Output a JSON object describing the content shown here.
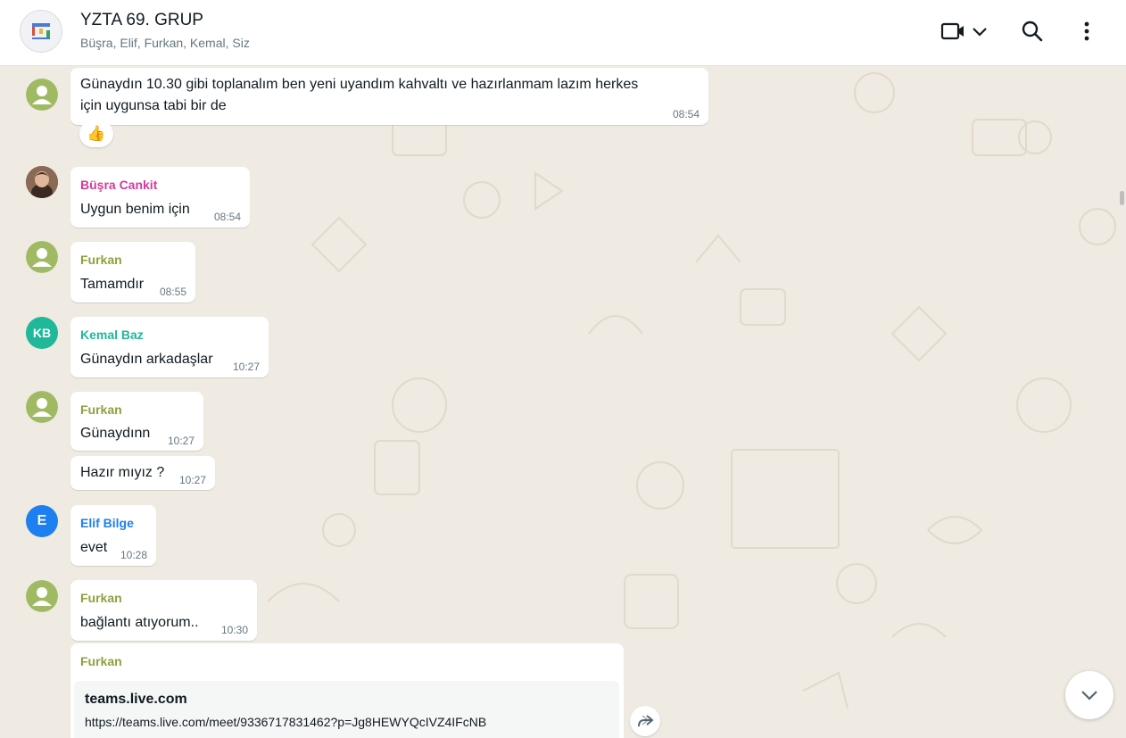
{
  "header": {
    "title": "YZTA 69. GRUP",
    "members": "Büşra, Elif, Furkan, Kemal, Siz"
  },
  "colors": {
    "background": "#efeae2",
    "furkan": "#8ba33b",
    "busra": "#d63a9c",
    "kemal": "#1fb89a",
    "elif": "#1d7ff0"
  },
  "icons": {
    "video_call": "video-camera",
    "dropdown": "chevron-down",
    "search": "magnifier",
    "menu": "vertical-dots",
    "reaction": "👍",
    "forward": "forward-arrow",
    "scroll_down": "chevron-down"
  },
  "messages": [
    {
      "sender": "",
      "text_line1": "Günaydın 10.30 gibi toplanalım ben yeni uyandım kahvaltı ve hazırlanmam lazım herkes",
      "text_line2": "için uygunsa tabi bir de",
      "time": "08:54",
      "reaction": "👍"
    },
    {
      "sender": "Büşra Cankit",
      "text": "Uygun benim için",
      "time": "08:54"
    },
    {
      "sender": "Furkan",
      "text": "Tamamdır",
      "time": "08:55"
    },
    {
      "sender": "Kemal Baz",
      "initials": "KB",
      "text": "Günaydın arkadaşlar",
      "time": "10:27"
    },
    {
      "sender": "Furkan",
      "text": "Günaydınn",
      "time": "10:27"
    },
    {
      "sender": "",
      "text": "Hazır mıyız ?",
      "time": "10:27"
    },
    {
      "sender": "Elif Bilge",
      "initials": "E",
      "text": "evet",
      "time": "10:28"
    },
    {
      "sender": "Furkan",
      "text": "bağlantı atıyorum..",
      "time": "10:30"
    },
    {
      "sender": "Furkan",
      "link_title": "teams.live.com",
      "link_url": "https://teams.live.com/meet/9336717831462?p=Jg8HEWYQcIVZ4IFcNB"
    }
  ]
}
